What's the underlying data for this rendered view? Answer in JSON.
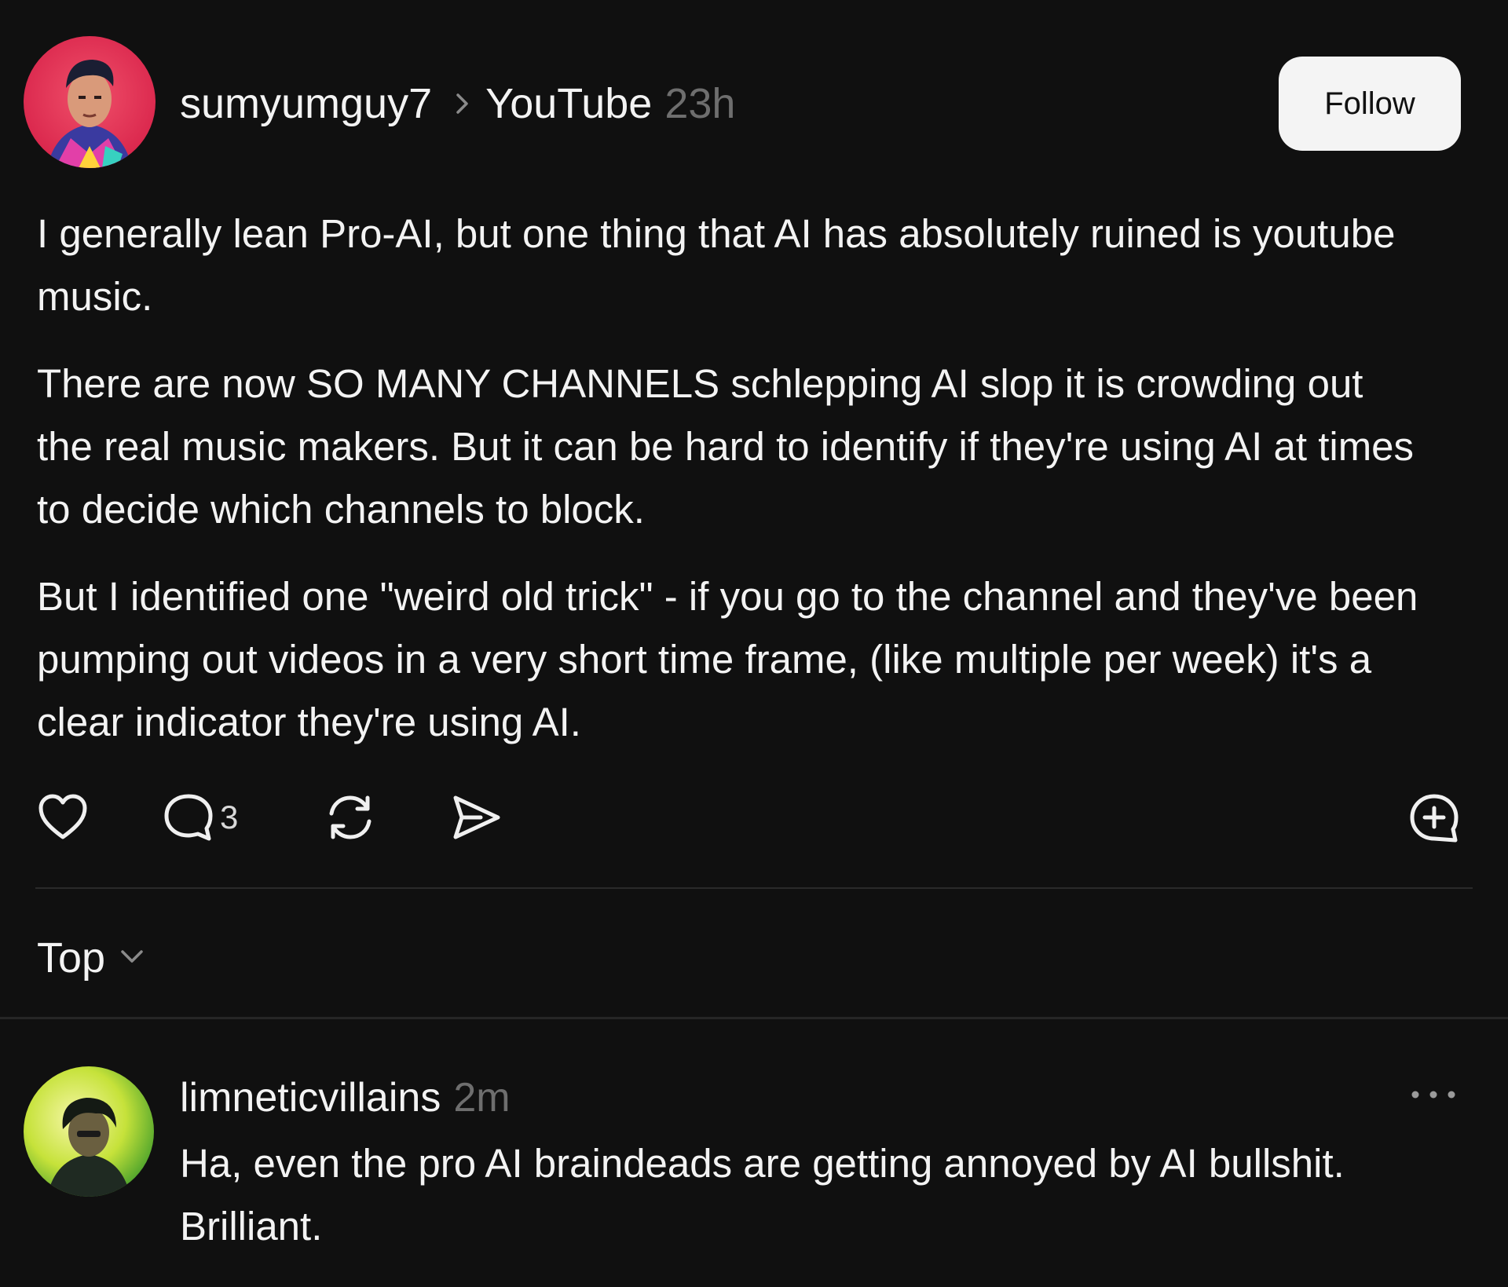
{
  "post": {
    "author": "sumyumguy7",
    "community": "YouTube",
    "time": "23h",
    "follow_label": "Follow",
    "paragraphs": [
      "I generally lean Pro-AI, but one thing that AI has absolutely ruined is youtube music.",
      "There are now SO MANY CHANNELS schlepping AI slop it is crowding out the real music makers. But it can be hard to identify if they're using AI at times to decide which channels to block.",
      "But I identified one \"weird old trick\" - if you go to the channel and they've been pumping out videos in a very short time frame, (like multiple per week) it's a clear indicator they're using AI."
    ],
    "actions": {
      "like_icon": "heart-icon",
      "reply_icon": "comment-bubble-icon",
      "reply_count": "3",
      "repost_icon": "repost-icon",
      "share_icon": "send-icon",
      "quote_icon": "add-comment-icon"
    }
  },
  "sort": {
    "label": "Top",
    "icon": "chevron-down-icon"
  },
  "reply": {
    "author": "limneticvillains",
    "time": "2m",
    "more_icon": "more-dots-icon",
    "text": "Ha, even the pro AI braindeads are getting annoyed by AI bullshit. Brilliant."
  },
  "colors": {
    "background": "#101010",
    "text": "#f3f3f3",
    "muted": "#6e6e6e",
    "button_bg": "#f4f4f4",
    "divider": "#2a2a2a"
  }
}
